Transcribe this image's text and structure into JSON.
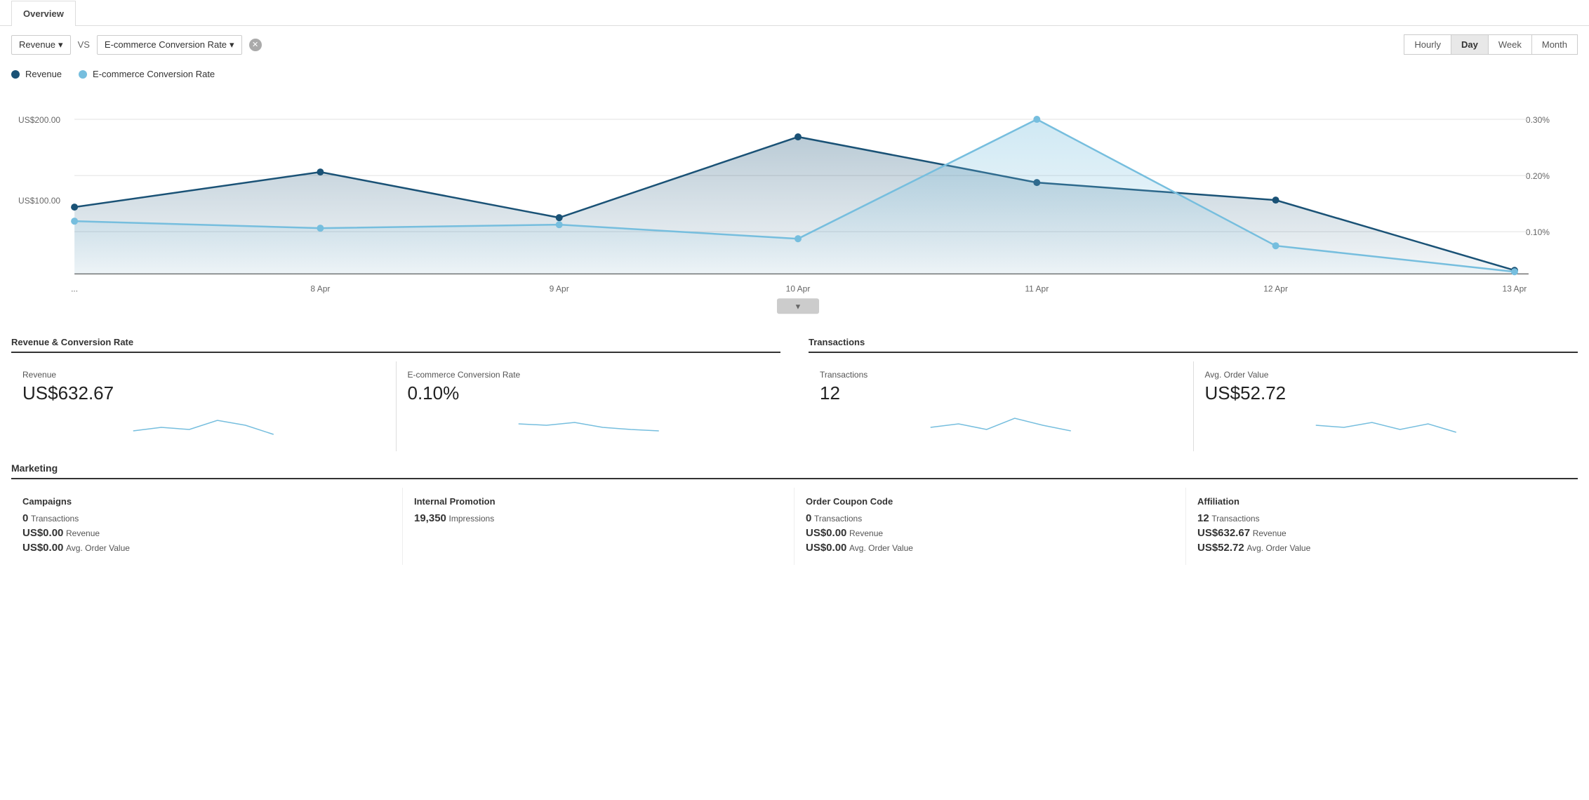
{
  "tabs": [
    {
      "label": "Overview",
      "active": true
    }
  ],
  "toolbar": {
    "metric1": "Revenue",
    "vs": "VS",
    "metric2": "E-commerce Conversion Rate",
    "timeButtons": [
      "Hourly",
      "Day",
      "Week",
      "Month"
    ],
    "activeTime": "Day"
  },
  "legend": [
    {
      "label": "Revenue",
      "type": "dark"
    },
    {
      "label": "E-commerce Conversion Rate",
      "type": "light"
    }
  ],
  "chart": {
    "yAxisLeft": [
      "US$200.00",
      "US$100.00"
    ],
    "yAxisRight": [
      "0.30%",
      "0.20%",
      "0.10%"
    ],
    "xAxisLabels": [
      "...",
      "8 Apr",
      "9 Apr",
      "10 Apr",
      "11 Apr",
      "12 Apr",
      "13 Apr"
    ]
  },
  "statsGroups": [
    {
      "title": "Revenue & Conversion Rate",
      "cards": [
        {
          "label": "Revenue",
          "value": "US$632.67"
        },
        {
          "label": "E-commerce Conversion Rate",
          "value": "0.10%"
        }
      ]
    },
    {
      "title": "Transactions",
      "cards": [
        {
          "label": "Transactions",
          "value": "12"
        },
        {
          "label": "Avg. Order Value",
          "value": "US$52.72"
        }
      ]
    }
  ],
  "marketing": {
    "title": "Marketing",
    "columns": [
      {
        "title": "Campaigns",
        "rows": [
          {
            "big": "0",
            "small": "Transactions"
          },
          {
            "big": "US$0.00",
            "small": "Revenue"
          },
          {
            "big": "US$0.00",
            "small": "Avg. Order Value"
          }
        ]
      },
      {
        "title": "Internal Promotion",
        "rows": [
          {
            "big": "19,350",
            "small": "Impressions"
          },
          {
            "big": "",
            "small": ""
          },
          {
            "big": "",
            "small": ""
          }
        ]
      },
      {
        "title": "Order Coupon Code",
        "rows": [
          {
            "big": "0",
            "small": "Transactions"
          },
          {
            "big": "US$0.00",
            "small": "Revenue"
          },
          {
            "big": "US$0.00",
            "small": "Avg. Order Value"
          }
        ]
      },
      {
        "title": "Affiliation",
        "rows": [
          {
            "big": "12",
            "small": "Transactions"
          },
          {
            "big": "US$632.67",
            "small": "Revenue"
          },
          {
            "big": "US$52.72",
            "small": "Avg. Order Value"
          }
        ]
      }
    ]
  }
}
